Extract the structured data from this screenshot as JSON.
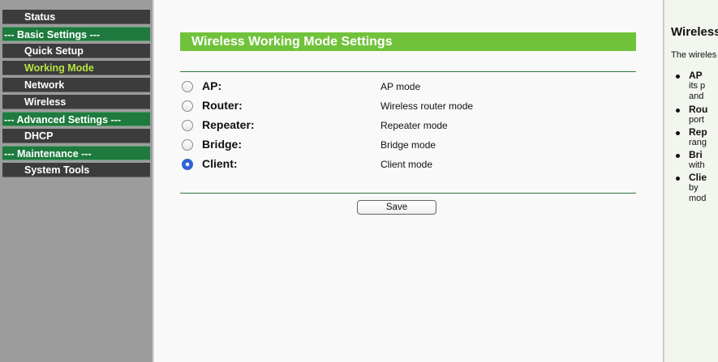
{
  "sidebar": {
    "items": [
      {
        "label": "Status",
        "type": "item"
      },
      {
        "label": "--- Basic Settings ---",
        "type": "group"
      },
      {
        "label": "Quick Setup",
        "type": "item"
      },
      {
        "label": "Working Mode",
        "type": "item",
        "active": true
      },
      {
        "label": "Network",
        "type": "item"
      },
      {
        "label": "Wireless",
        "type": "item"
      },
      {
        "label": "--- Advanced Settings ---",
        "type": "group"
      },
      {
        "label": "DHCP",
        "type": "item"
      },
      {
        "label": "--- Maintenance ---",
        "type": "group"
      },
      {
        "label": "System Tools",
        "type": "item"
      }
    ]
  },
  "main": {
    "title": "Wireless Working Mode Settings",
    "modes": [
      {
        "label": "AP:",
        "description": "AP mode",
        "checked": false
      },
      {
        "label": "Router:",
        "description": "Wireless router mode",
        "checked": false
      },
      {
        "label": "Repeater:",
        "description": "Repeater mode",
        "checked": false
      },
      {
        "label": "Bridge:",
        "description": "Bridge mode",
        "checked": false
      },
      {
        "label": "Client:",
        "description": "Client mode",
        "checked": true
      }
    ],
    "save_label": "Save"
  },
  "help": {
    "title": "Wireless",
    "intro": "The wireles",
    "items": [
      {
        "head": "AP",
        "lines": [
          "its p",
          "and"
        ]
      },
      {
        "head": "Rou",
        "lines": [
          "port"
        ]
      },
      {
        "head": "Rep",
        "lines": [
          "rang"
        ]
      },
      {
        "head": "Bri",
        "lines": [
          "with"
        ]
      },
      {
        "head": "Clie",
        "lines": [
          "by",
          "mod"
        ]
      }
    ]
  },
  "colors": {
    "menu_item_bg": "#3c3c3c",
    "menu_group_bg": "#1e7a3e",
    "active_text": "#b7e343",
    "title_bar_bg": "#71c23b",
    "rule": "#2f7a3c"
  }
}
